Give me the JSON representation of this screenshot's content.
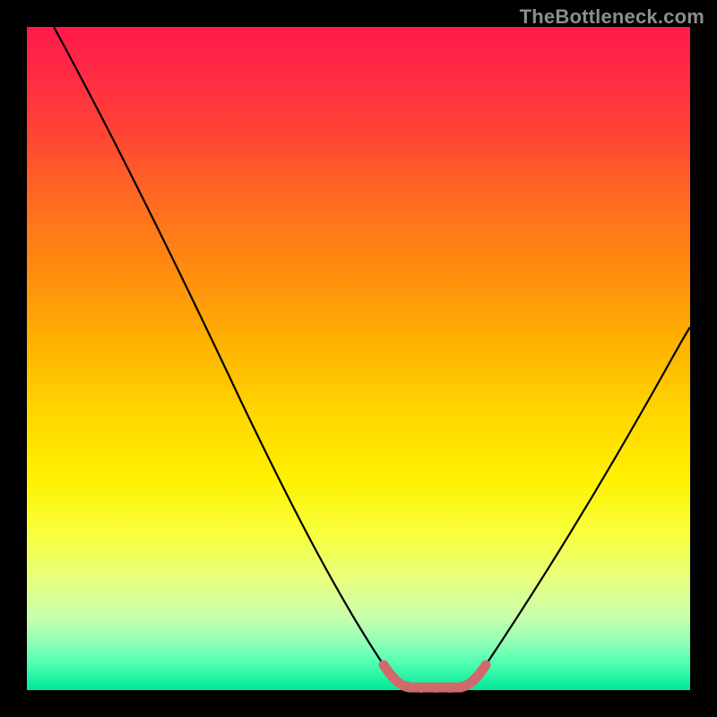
{
  "watermark": "TheBottleneck.com",
  "chart_data": {
    "type": "line",
    "title": "",
    "xlabel": "",
    "ylabel": "",
    "xlim": [
      0,
      100
    ],
    "ylim": [
      0,
      100
    ],
    "legend": false,
    "background": "heat-gradient (red→yellow→green)",
    "note": "Axes not labeled in image; x/y are normalized 0–100 estimates from pixel positions. Curve shows bottleneck %: high at left, drops to ≈0 around x≈57–67 (flat minimum highlighted pink), rises again toward right.",
    "series": [
      {
        "name": "bottleneck-curve",
        "color": "#000000",
        "x": [
          4,
          8,
          12,
          16,
          20,
          24,
          28,
          32,
          36,
          40,
          44,
          48,
          52,
          55,
          57,
          60,
          63,
          65,
          67,
          70,
          74,
          78,
          82,
          86,
          90,
          94,
          98,
          100
        ],
        "y": [
          100,
          93,
          86,
          79,
          72,
          65,
          58,
          51,
          44,
          37,
          30,
          23,
          14,
          7,
          2,
          0.8,
          0.6,
          0.8,
          2,
          6,
          12,
          19,
          26,
          33,
          39,
          45,
          51,
          54
        ]
      },
      {
        "name": "optimal-zone-marker",
        "color": "#d06a6a",
        "x": [
          55,
          57,
          58,
          60,
          62,
          64,
          65,
          66,
          67
        ],
        "y": [
          7,
          2,
          1,
          0.8,
          0.6,
          0.8,
          1,
          1.5,
          2
        ]
      }
    ]
  }
}
